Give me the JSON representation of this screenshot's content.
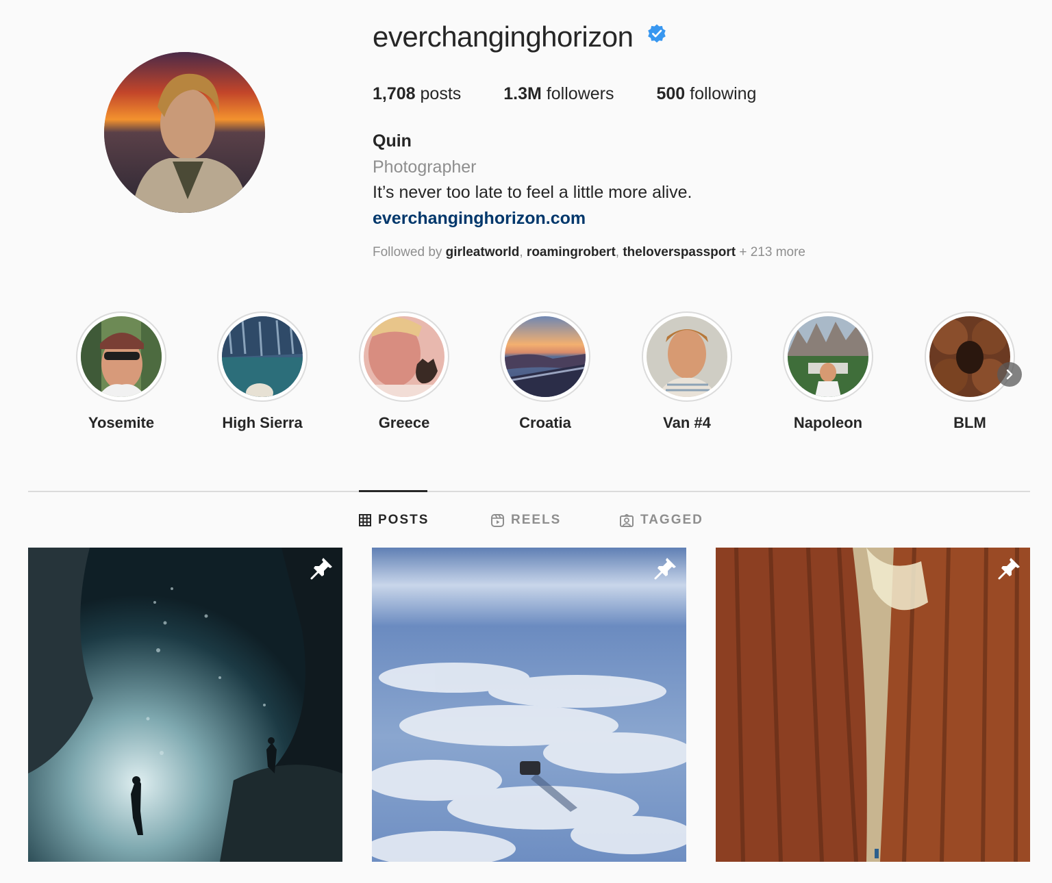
{
  "profile": {
    "username": "everchanginghorizon",
    "verified": true,
    "stats": {
      "posts_count": "1,708",
      "posts_label": "posts",
      "followers_count": "1.3M",
      "followers_label": "followers",
      "following_count": "500",
      "following_label": "following"
    },
    "full_name": "Quin",
    "category": "Photographer",
    "bio": "It’s never too late to feel a little more alive.",
    "website": "everchanginghorizon.com",
    "followed_by": {
      "prefix": "Followed by",
      "users": [
        "girleatworld",
        "roamingrobert",
        "theloverspassport"
      ],
      "more": "+ 213 more"
    }
  },
  "highlights": [
    {
      "label": "Yosemite"
    },
    {
      "label": "High Sierra"
    },
    {
      "label": "Greece"
    },
    {
      "label": "Croatia"
    },
    {
      "label": "Van #4"
    },
    {
      "label": "Napoleon"
    },
    {
      "label": "BLM"
    }
  ],
  "tabs": [
    {
      "label": "POSTS",
      "icon": "grid-icon",
      "active": true
    },
    {
      "label": "REELS",
      "icon": "reels-icon",
      "active": false
    },
    {
      "label": "TAGGED",
      "icon": "tagged-icon",
      "active": false
    }
  ],
  "posts": [
    {
      "subject": "underwater cave divers",
      "pinned": true
    },
    {
      "subject": "van on salt flat reflecting clouds",
      "pinned": true
    },
    {
      "subject": "giant sequoia trees",
      "pinned": true
    }
  ],
  "colors": {
    "verified": "#3897f0",
    "link": "#00376b",
    "muted": "#8e8e8e",
    "text": "#262626"
  }
}
